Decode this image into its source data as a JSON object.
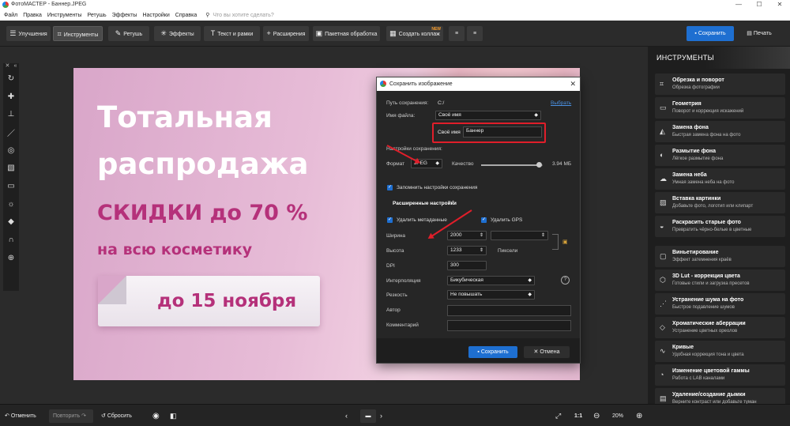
{
  "window": {
    "title": "ФотоМАСТЕР - Баннер.JPEG",
    "controls": [
      "—",
      "☐",
      "✕"
    ]
  },
  "menu": {
    "items": [
      "Файл",
      "Правка",
      "Инструменты",
      "Ретушь",
      "Эффекты",
      "Настройки",
      "Справка"
    ],
    "search_placeholder": "Что вы хотите сделать?"
  },
  "toolbar": {
    "tabs": [
      {
        "label": "Улучшения",
        "icon": "sliders-icon"
      },
      {
        "label": "Инструменты",
        "icon": "crop-icon",
        "active": true
      },
      {
        "label": "Ретушь",
        "icon": "brush-icon"
      },
      {
        "label": "Эффекты",
        "icon": "sparkle-icon"
      },
      {
        "label": "Текст и рамки",
        "icon": "text-icon"
      },
      {
        "label": "Расширения",
        "icon": "plus-icon"
      },
      {
        "label": "Пакетная обработка",
        "icon": "batch-icon"
      },
      {
        "label": "Создать коллаж",
        "icon": "collage-icon",
        "badge": "NEW"
      }
    ],
    "save_label": "Сохранить",
    "print_label": "Печать"
  },
  "canvas": {
    "headline1": "Тотальная",
    "headline2": "распродажа",
    "discount": "СКИДКИ до 70 %",
    "sub": "на всю косметику",
    "date": "до 15 ноября"
  },
  "dialog": {
    "title": "Сохранить изображение",
    "path_label": "Путь сохранения:",
    "path_value": "C:/",
    "path_link": "Выбрать",
    "filename_label": "Имя файла:",
    "filename_value": "Своё имя",
    "custom_name_label": "Своё имя",
    "custom_name_value": "Баннер",
    "settings_label": "Настройки сохранения:",
    "format_label": "Формат",
    "format_value": "JPEG",
    "quality_label": "Качество",
    "quality_fraction": 0.94,
    "size_value": "3.94 МБ",
    "remember_label": "Запомнить настройки сохранения",
    "advanced_label": "Расширенные настройки",
    "remove_meta_label": "Удалить метаданные",
    "remove_gps_label": "Удалить GPS",
    "width_label": "Ширина",
    "width_value": "2000",
    "height_label": "Высота",
    "height_value": "1233",
    "units_value": "Пиксели",
    "dpi_label": "DPI",
    "dpi_value": "300",
    "interp_label": "Интерполяция",
    "interp_value": "Бикубическая",
    "sharp_label": "Резкость",
    "sharp_value": "Не повышать",
    "author_label": "Автор",
    "comment_label": "Комментарий",
    "save_label": "Сохранить",
    "cancel_label": "Отмена"
  },
  "right_panel": {
    "title": "ИНСТРУМЕНТЫ",
    "items": [
      {
        "title": "Обрезка и поворот",
        "sub": "Обрезка фотографии"
      },
      {
        "title": "Геометрия",
        "sub": "Поворот и коррекция искажений"
      },
      {
        "title": "Замена фона",
        "sub": "Быстрая замена фона на фото"
      },
      {
        "title": "Размытие фона",
        "sub": "Лёгкое размытие фона"
      },
      {
        "title": "Замена неба",
        "sub": "Умная замена неба на фото"
      },
      {
        "title": "Вставка картинки",
        "sub": "Добавьте фото, логотип или клипарт"
      },
      {
        "title": "Раскрасить старые фото",
        "sub": "Превратить чёрно-белые в цветные"
      },
      {
        "title": "Виньетирование",
        "sub": "Эффект затемнения краёв"
      },
      {
        "title": "3D Lut - коррекция цвета",
        "sub": "Готовые стили и загрузка пресетов"
      },
      {
        "title": "Устранение шума на фото",
        "sub": "Быстрое подавление шумов"
      },
      {
        "title": "Хроматические аберрации",
        "sub": "Устранение цветных ореолов"
      },
      {
        "title": "Кривые",
        "sub": "Удобная коррекция тона и цвета"
      },
      {
        "title": "Изменение цветовой гаммы",
        "sub": "Работа с LAB каналами"
      },
      {
        "title": "Удаление/создание дымки",
        "sub": "Верните контраст или добавьте туман"
      }
    ]
  },
  "bottom": {
    "undo": "Отменить",
    "redo": "Повторить",
    "reset": "Сбросить",
    "ratio": "1:1",
    "zoom": "20%"
  }
}
